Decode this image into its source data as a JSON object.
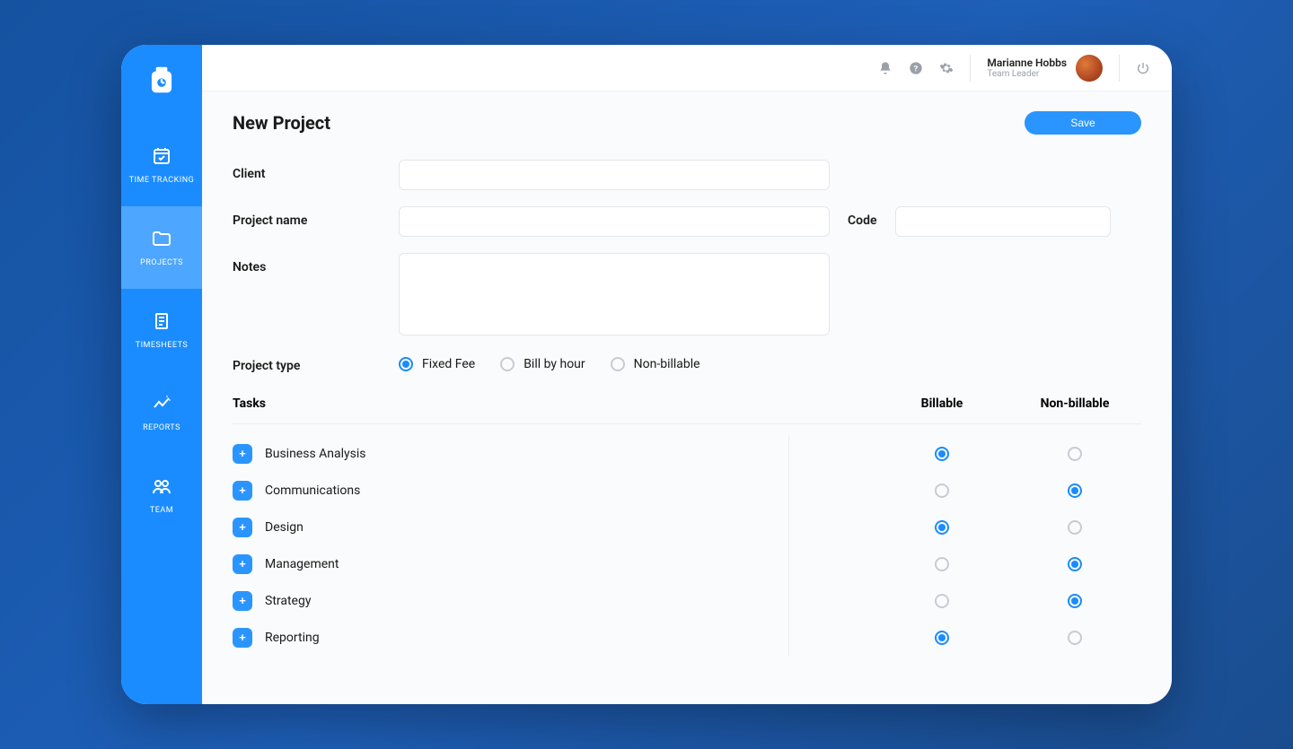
{
  "sidebar": {
    "items": [
      {
        "label": "TIME TRACKING"
      },
      {
        "label": "PROJECTS"
      },
      {
        "label": "TIMESHEETS"
      },
      {
        "label": "REPORTS"
      },
      {
        "label": "TEAM"
      }
    ]
  },
  "user": {
    "name": "Marianne Hobbs",
    "role": "Team Leader"
  },
  "page": {
    "title": "New Project",
    "saveLabel": "Save"
  },
  "form": {
    "clientLabel": "Client",
    "clientValue": "",
    "projectNameLabel": "Project name",
    "projectNameValue": "",
    "codeLabel": "Code",
    "codeValue": "",
    "notesLabel": "Notes",
    "notesValue": "",
    "projectTypeLabel": "Project type",
    "projectTypes": [
      {
        "label": "Fixed Fee",
        "selected": true
      },
      {
        "label": "Bill by hour",
        "selected": false
      },
      {
        "label": "Non-billable",
        "selected": false
      }
    ]
  },
  "tasks": {
    "headerLabel": "Tasks",
    "billableLabel": "Billable",
    "nonBillableLabel": "Non-billable",
    "rows": [
      {
        "name": "Business Analysis",
        "billable": true
      },
      {
        "name": "Communications",
        "billable": false
      },
      {
        "name": "Design",
        "billable": true
      },
      {
        "name": "Management",
        "billable": false
      },
      {
        "name": "Strategy",
        "billable": false
      },
      {
        "name": "Reporting",
        "billable": true
      }
    ]
  }
}
